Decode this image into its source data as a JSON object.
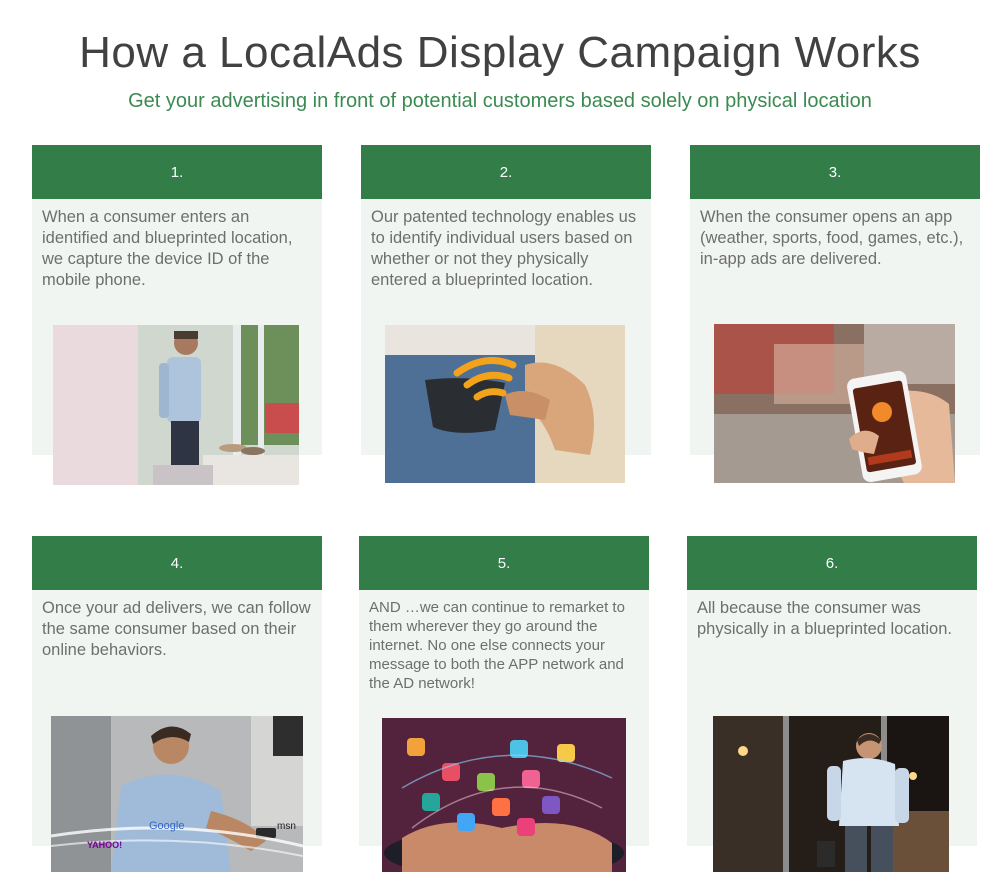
{
  "header": {
    "title": "How a LocalAds Display Campaign Works",
    "subtitle": "Get your advertising in front of potential customers based solely on physical location"
  },
  "steps": [
    {
      "number": "1.",
      "text": "When a consumer enters an identified and blueprinted location, we capture the device ID of the mobile phone.",
      "image": "man-in-store-photo"
    },
    {
      "number": "2.",
      "text": "Our patented technology enables us to identify individual users based on whether or not they physically entered a blueprinted location.",
      "image": "phone-in-pocket-photo"
    },
    {
      "number": "3.",
      "text": "When the consumer opens an app (weather, sports, food, games, etc.), in-app ads are delivered.",
      "image": "hand-holding-phone-photo"
    },
    {
      "number": "4.",
      "text": "Once your ad delivers, we can follow the same consumer based on their online behaviors.",
      "image": "man-on-phone-photo"
    },
    {
      "number": "5.",
      "text": "AND …we can continue to remarket to them wherever they go around the internet.  No one else connects your message to both the APP network and the AD network!",
      "image": "tablet-app-icons-photo"
    },
    {
      "number": "6.",
      "text": "All because the consumer was physically in a blueprinted location.",
      "image": "man-exiting-store-photo"
    }
  ],
  "logos": {
    "google": "Google",
    "yahoo": "YAHOO!",
    "msn": "msn"
  },
  "colors": {
    "header_green": "#327d48",
    "subtitle_green": "#3b8a52",
    "panel_bg": "#f1f5f1",
    "body_text": "#6e6e6e",
    "title_text": "#414141"
  }
}
